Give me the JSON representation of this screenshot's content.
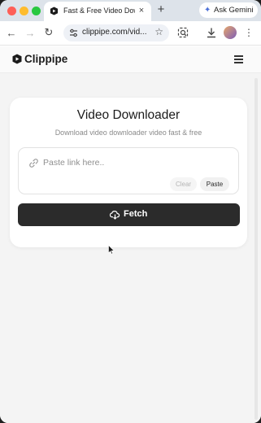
{
  "browser": {
    "tab": {
      "title": "Fast & Free Video Downlo",
      "close": "×"
    },
    "new_tab": "+",
    "ask_gemini": {
      "spark": "✦",
      "label": "Ask Gemini"
    },
    "toolbar": {
      "back": "←",
      "forward": "→",
      "reload": "↻",
      "url": "clippipe.com/vid...",
      "star": "☆",
      "menu": "⋮"
    }
  },
  "site": {
    "logo_text": "Clippipe"
  },
  "downloader": {
    "title": "Video Downloader",
    "subtitle": "Download video downloader video fast & free",
    "input": {
      "value": "",
      "placeholder": "Paste link here.."
    },
    "clear_label": "Clear",
    "paste_label": "Paste",
    "fetch_label": "Fetch"
  },
  "colors": {
    "fetch_button": "#2b2b2b",
    "page_bg": "#f4f4f4",
    "tab_strip": "#dde3ea",
    "gemini_spark": "#4a6fd8"
  },
  "icons": [
    "close-icon",
    "plus-icon",
    "sparkle-icon",
    "back-arrow-icon",
    "forward-arrow-icon",
    "reload-icon",
    "tune-icon",
    "star-icon",
    "lens-icon",
    "download-icon",
    "kebab-menu-icon",
    "logo-icon",
    "hamburger-icon",
    "link-icon",
    "cloud-download-icon",
    "mouse-cursor-icon"
  ]
}
